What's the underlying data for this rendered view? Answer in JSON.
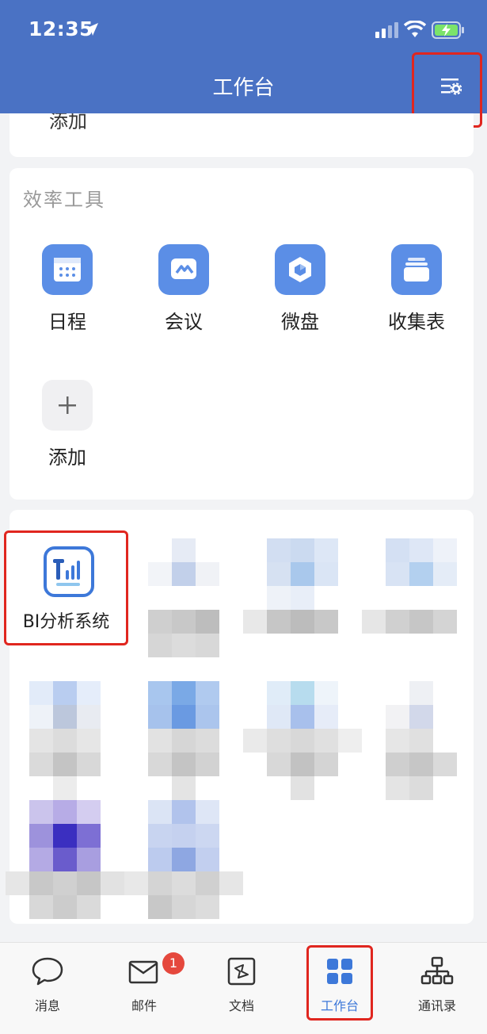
{
  "status_bar": {
    "time": "12:35"
  },
  "header": {
    "title": "工作台"
  },
  "top_card": {
    "partial_label": "添加"
  },
  "tools_section": {
    "title": "效率工具",
    "items": [
      {
        "label": "日程",
        "icon": "calendar-icon"
      },
      {
        "label": "会议",
        "icon": "meeting-icon"
      },
      {
        "label": "微盘",
        "icon": "drive-icon"
      },
      {
        "label": "收集表",
        "icon": "form-icon"
      },
      {
        "label": "添加",
        "icon": "plus-icon"
      }
    ]
  },
  "apps_section": {
    "highlighted_app": {
      "label": "BI分析系统",
      "icon": "bi-chart-icon"
    }
  },
  "tabbar": {
    "tabs": [
      {
        "label": "消息",
        "icon": "chat-bubble-icon"
      },
      {
        "label": "邮件",
        "icon": "mail-icon",
        "badge": "1"
      },
      {
        "label": "文档",
        "icon": "document-icon"
      },
      {
        "label": "工作台",
        "icon": "grid-icon",
        "active": true
      },
      {
        "label": "通讯录",
        "icon": "org-chart-icon"
      }
    ]
  },
  "colors": {
    "header": "#4a72c4",
    "accent": "#3d78d9",
    "highlight_border": "#e0261f"
  }
}
